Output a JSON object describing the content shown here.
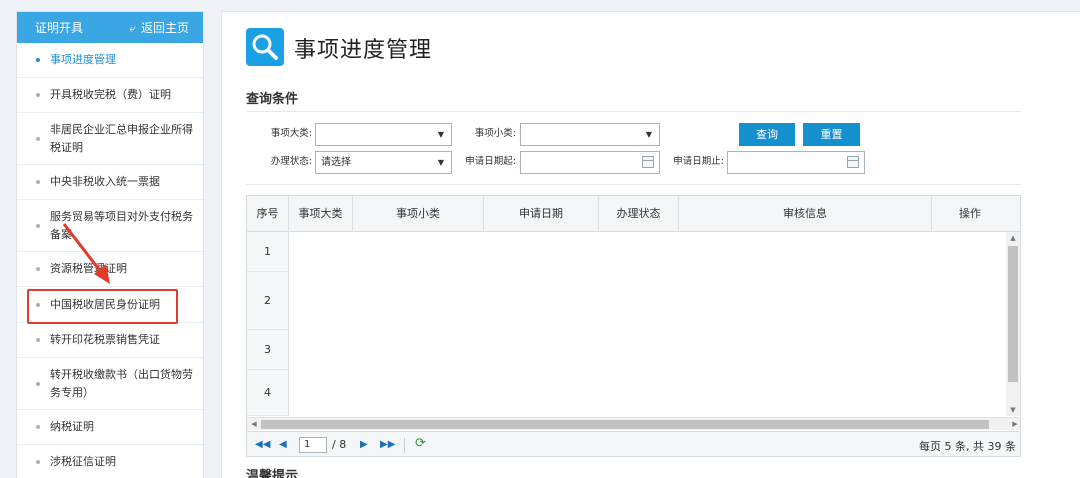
{
  "sidebar": {
    "title": "证明开具",
    "home_label": "返回主页",
    "items": [
      "事项进度管理",
      "开具税收完税（费）证明",
      "非居民企业汇总申报企业所得税证明",
      "中央非税收入统一票据",
      "服务贸易等项目对外支付税务备案",
      "资源税管理证明",
      "中国税收居民身份证明",
      "转开印花税票销售凭证",
      "转开税收缴款书（出口货物劳务专用）",
      "纳税证明",
      "涉税征信证明"
    ],
    "active_index": 0,
    "highlighted_index": 6
  },
  "main": {
    "page_title": "事项进度管理",
    "query_section": "查询条件",
    "form": {
      "major_label": "事项大类:",
      "major_value": "",
      "minor_label": "事项小类:",
      "minor_value": "",
      "status_label": "办理状态:",
      "status_value": "请选择",
      "date_from_label": "申请日期起:",
      "date_to_label": "申请日期止:",
      "search_btn": "查询",
      "reset_btn": "重置"
    },
    "grid": {
      "columns": [
        "序号",
        "事项大类",
        "事项小类",
        "申请日期",
        "办理状态",
        "审核信息",
        "操作"
      ],
      "row_numbers": [
        "1",
        "2",
        "3",
        "4"
      ],
      "pager": {
        "current_page": "1",
        "total_pages": "/ 8",
        "info": "每页 5 条, 共 39 条"
      }
    },
    "tips_title": "温馨提示"
  },
  "colors": {
    "primary": "#1590cf",
    "sidebar_header": "#3aa6e3",
    "highlight": "#e33a2e"
  }
}
